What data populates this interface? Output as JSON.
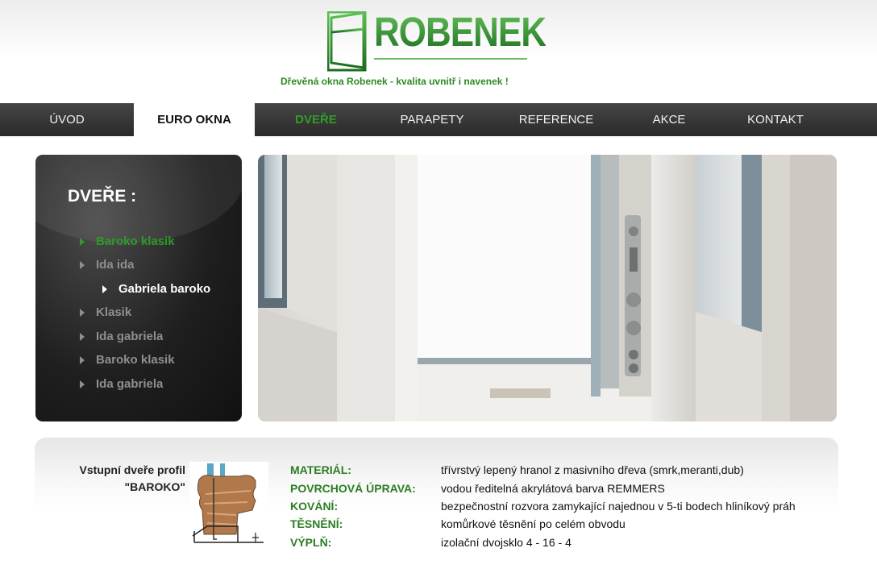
{
  "header": {
    "logo_text": "ROBENEK",
    "tagline": "Dřevěná okna Robenek - kvalita uvnitř i navenek !"
  },
  "nav": {
    "items": [
      {
        "label": "ÚVOD"
      },
      {
        "label": "EURO OKNA"
      },
      {
        "label": "DVEŘE"
      },
      {
        "label": "PARAPETY"
      },
      {
        "label": "REFERENCE"
      },
      {
        "label": "AKCE"
      },
      {
        "label": "KONTAKT"
      }
    ],
    "active": "EURO OKNA",
    "highlighted": "DVEŘE"
  },
  "sidebar": {
    "title": "DVEŘE :",
    "items": [
      {
        "label": "Baroko klasik"
      },
      {
        "label": "Ida ida"
      },
      {
        "label": "Gabriela baroko"
      },
      {
        "label": "Klasik"
      },
      {
        "label": "Ida gabriela"
      },
      {
        "label": "Baroko klasik"
      },
      {
        "label": "Ida gabriela"
      }
    ]
  },
  "profile": {
    "caption_line1": "Vstupní dveře profil",
    "caption_line2": "\"BAROKO\""
  },
  "specs": [
    {
      "label": "MATERIÁL:",
      "value": "třívrstvý lepený hranol z masivního dřeva (smrk,meranti,dub)"
    },
    {
      "label": "POVRCHOVÁ ÚPRAVA:",
      "value": "vodou ředitelná akrylátová barva REMMERS"
    },
    {
      "label": "KOVÁNÍ:",
      "value": "bezpečnostní rozvora zamykající najednou v 5-ti bodech hliníkový práh"
    },
    {
      "label": "TĚSNĚNÍ:",
      "value": "komůrkové těsnění po celém obvodu"
    },
    {
      "label": "VÝPLŇ:",
      "value": "izolační dvojsklo 4 - 16 - 4"
    }
  ],
  "colors": {
    "brand_green": "#2f9a28",
    "nav_dark": "#333333",
    "label_green": "#2b7d22"
  }
}
